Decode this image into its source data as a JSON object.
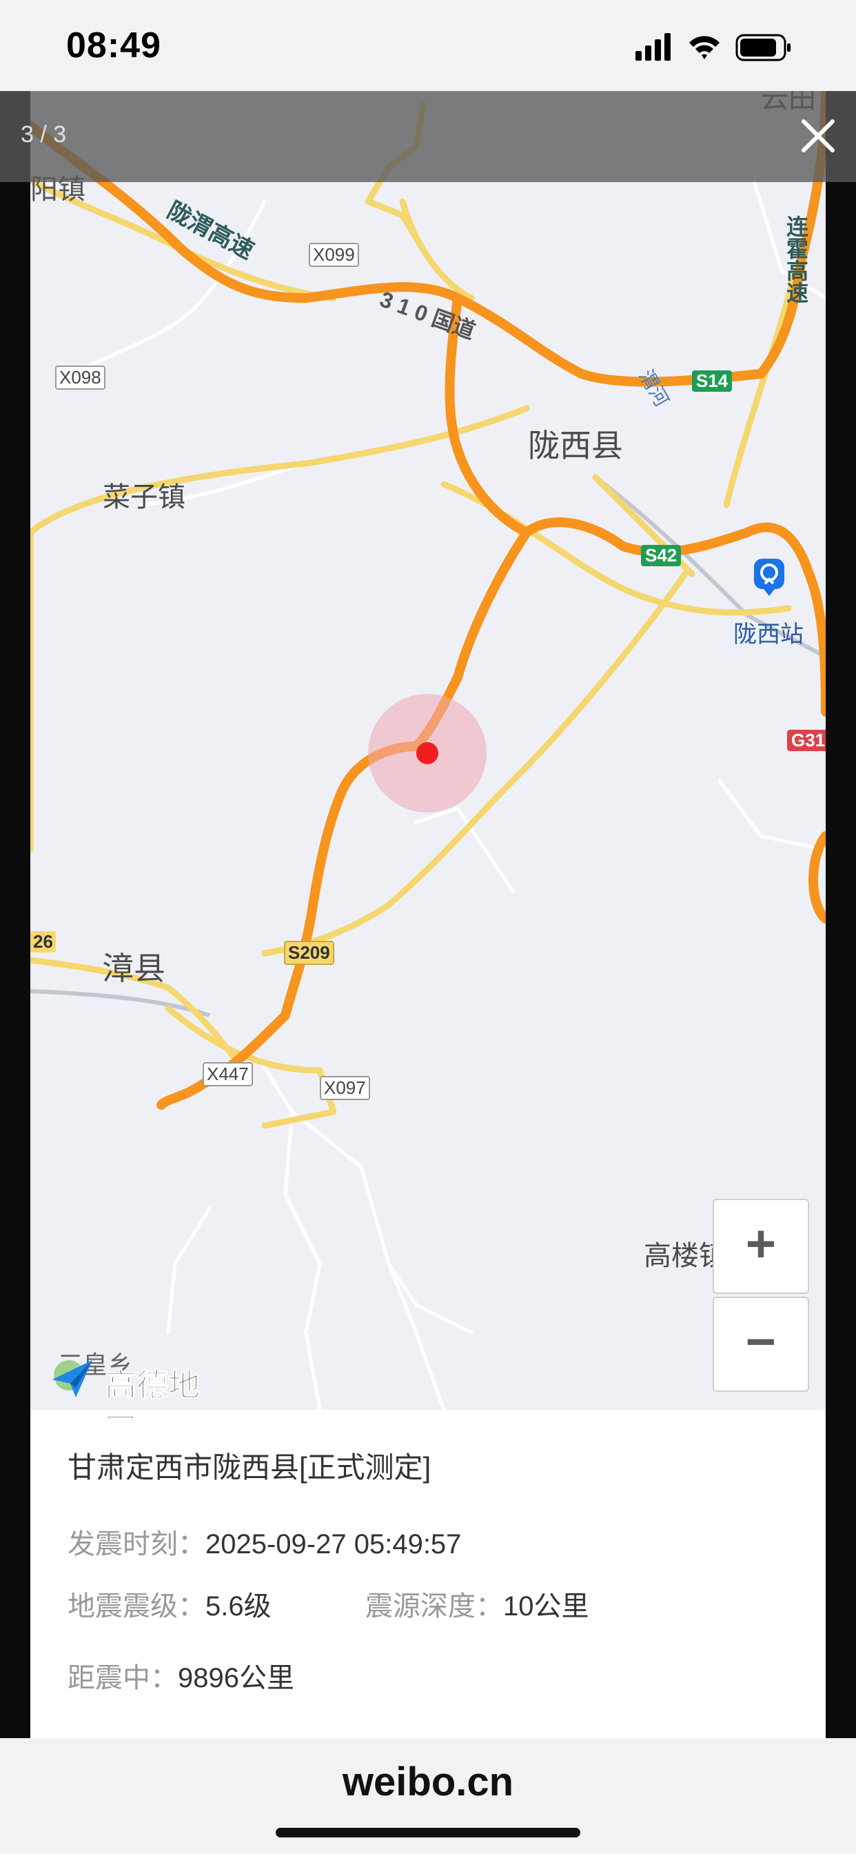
{
  "status": {
    "time": "08:49"
  },
  "viewer": {
    "counter": "3 / 3"
  },
  "map": {
    "labels": {
      "yangzhen": "阳镇",
      "longwei": "陇渭高速",
      "x099": "X099",
      "g310": "3 1 0 国道",
      "x098": "X098",
      "longxi": "陇西县",
      "weihe": "渭河",
      "s14": "S14",
      "lianhuo": "连霍高速",
      "caizi": "菜子镇",
      "s42": "S42",
      "longxi_station": "陇西站",
      "g31": "G31",
      "s209": "S209",
      "zhangxian": "漳县",
      "n26": "26",
      "x447": "X447",
      "x097": "X097",
      "gaolou": "高楼镇",
      "top_right": "云田",
      "bottom_left": "三皇乡"
    },
    "logo": "高德地图",
    "zoom_in": "+",
    "zoom_out": "−"
  },
  "quake": {
    "title": "甘肃定西市陇西县[正式测定]",
    "time_label": "发震时刻：",
    "time_value": "2025-09-27 05:49:57",
    "mag_label": "地震震级：",
    "mag_value": "5.6级",
    "depth_label": "震源深度：",
    "depth_value": "10公里",
    "dist_label": "距震中：",
    "dist_value": "9896公里"
  },
  "browser": {
    "domain": "weibo.cn"
  },
  "colors": {
    "highway": "#f7941d",
    "road": "#f5d76e",
    "epicenter": "#f01e1e"
  }
}
